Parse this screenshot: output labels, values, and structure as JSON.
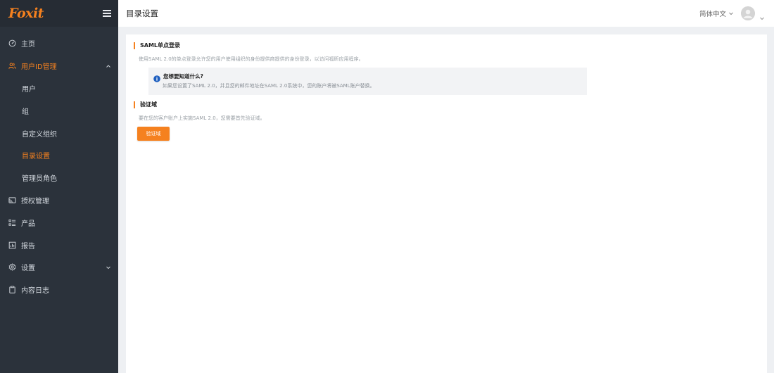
{
  "brand": {
    "logo_text": "Foxit",
    "accent_color": "#f5811f",
    "sidebar_bg": "#2b323b"
  },
  "sidebar": {
    "items": [
      {
        "label": "主页",
        "icon": "dashboard-icon"
      },
      {
        "label": "用户ID管理",
        "icon": "users-icon",
        "expanded": true
      },
      {
        "label": "用户"
      },
      {
        "label": "组"
      },
      {
        "label": "自定义组织"
      },
      {
        "label": "目录设置",
        "active": true
      },
      {
        "label": "管理员角色"
      },
      {
        "label": "授权管理",
        "icon": "cast-icon"
      },
      {
        "label": "产品",
        "icon": "list-icon"
      },
      {
        "label": "报告",
        "icon": "report-icon"
      },
      {
        "label": "设置",
        "icon": "gear-icon",
        "expanded": false
      },
      {
        "label": "内容日志",
        "icon": "clipboard-icon"
      }
    ]
  },
  "header": {
    "title": "目录设置",
    "language": "简体中文"
  },
  "main": {
    "saml": {
      "title": "SAML单点登录",
      "description": "使用SAML 2.0的单点登录允许您的用户使用组织的身份提供商提供的身份登录，以访问福昕应用程序。",
      "info_title": "您想要知道什么?",
      "info_text": "如果您设置了SAML 2.0，并且您的邮件地址在SAML 2.0系统中，您的账户将被SAML账户替换。"
    },
    "domain": {
      "title": "验证域",
      "description": "要在您的客户账户上实施SAML 2.0，您需要首先验证域。",
      "button_label": "验证域"
    }
  }
}
